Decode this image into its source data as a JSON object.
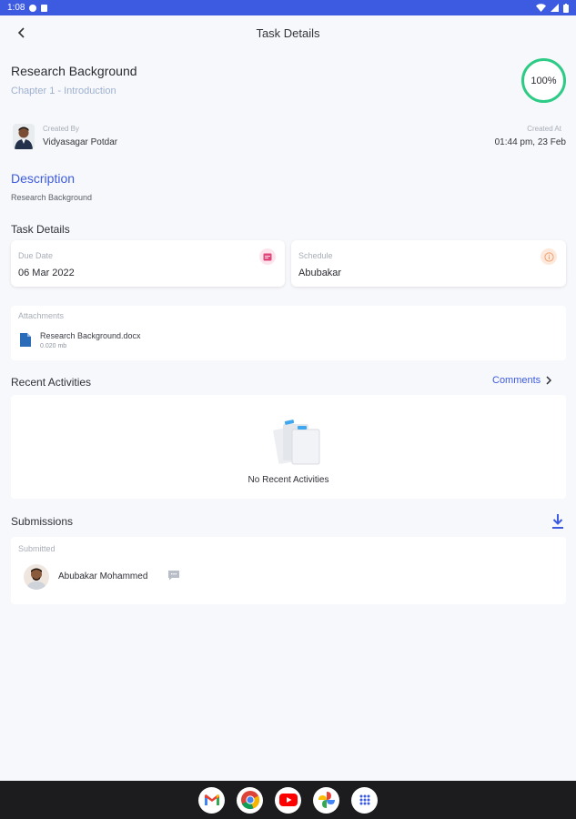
{
  "status_bar": {
    "time": "1:08"
  },
  "app_bar": {
    "title": "Task Details"
  },
  "task": {
    "title": "Research Background",
    "chapter": "Chapter 1 - Introduction",
    "progress_label": "100%",
    "progress_value": 100
  },
  "meta": {
    "created_by_label": "Created By",
    "created_by": "Vidyasagar Potdar",
    "created_at_label": "Created At",
    "created_at": "01:44 pm, 23 Feb"
  },
  "description": {
    "heading": "Description",
    "text": "Research Background"
  },
  "task_details": {
    "heading": "Task Details",
    "due_date_label": "Due Date",
    "due_date": "06 Mar 2022",
    "schedule_label": "Schedule",
    "schedule": "Abubakar"
  },
  "attachments": {
    "label": "Attachments",
    "items": [
      {
        "name": "Research Background.docx",
        "size": "0.020 mb"
      }
    ]
  },
  "recent": {
    "heading": "Recent Activities",
    "comments_link": "Comments",
    "empty_text": "No Recent Activities"
  },
  "submissions": {
    "heading": "Submissions",
    "label": "Submitted",
    "items": [
      {
        "name": "Abubakar Mohammed"
      }
    ]
  },
  "nav_apps": [
    "gmail-icon",
    "chrome-icon",
    "youtube-icon",
    "photos-icon",
    "apps-grid-icon"
  ],
  "colors": {
    "accent": "#3d5be0",
    "progress": "#2ecb86",
    "due_icon": "#e0467a",
    "schedule_icon": "#f0a070"
  }
}
